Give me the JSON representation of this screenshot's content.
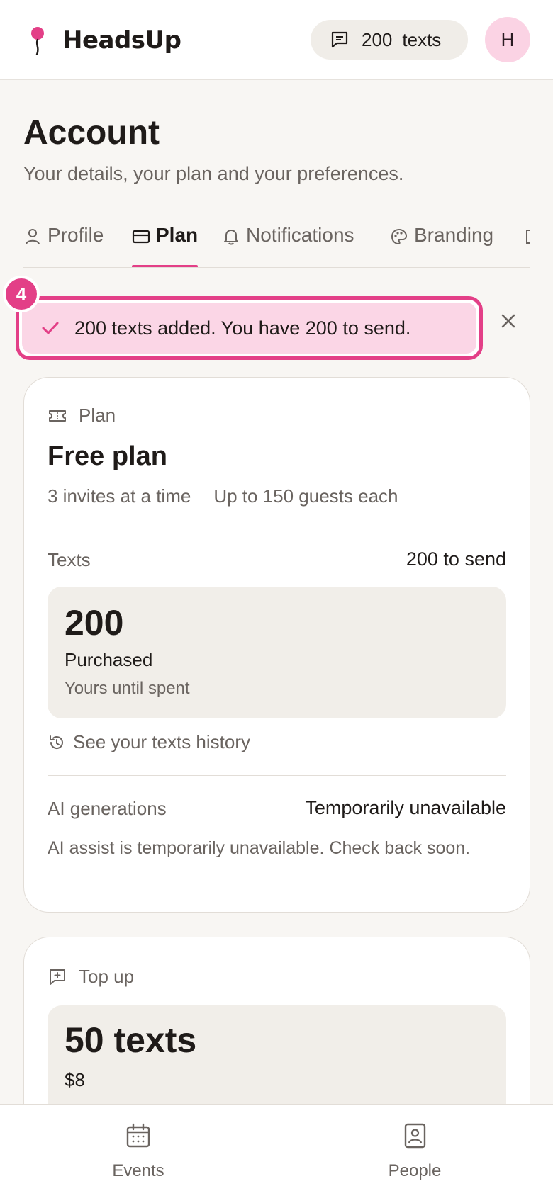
{
  "header": {
    "brand": "HeadsUp",
    "credits_count": "200",
    "credits_unit": "texts",
    "avatar_initial": "H"
  },
  "page": {
    "title": "Account",
    "subtitle": "Your details, your plan and your preferences."
  },
  "tabs": [
    {
      "label": "Profile",
      "icon": "user-icon",
      "active": false
    },
    {
      "label": "Plan",
      "icon": "card-icon",
      "active": true
    },
    {
      "label": "Notifications",
      "icon": "bell-icon",
      "active": false
    },
    {
      "label": "Branding",
      "icon": "palette-icon",
      "active": false
    }
  ],
  "toast": {
    "message": "200 texts added. You have 200 to send.",
    "step_badge": "4"
  },
  "plan_card": {
    "section_label": "Plan",
    "plan_name": "Free plan",
    "meta_invites": "3 invites at a time",
    "meta_guests": "Up to 150 guests each",
    "texts_label": "Texts",
    "texts_value": "200 to send",
    "stat_number": "200",
    "stat_title": "Purchased",
    "stat_sub": "Yours until spent",
    "history_link": "See your texts history",
    "ai_label": "AI generations",
    "ai_value": "Temporarily unavailable",
    "ai_note": "AI assist is temporarily unavailable. Check back soon."
  },
  "topup_card": {
    "section_label": "Top up",
    "pack_title": "50 texts",
    "pack_price": "$8"
  },
  "bottom_nav": {
    "events": "Events",
    "people": "People"
  },
  "colors": {
    "accent": "#e33f87",
    "toast_bg": "#fbd6e6",
    "background": "#f8f6f3"
  }
}
